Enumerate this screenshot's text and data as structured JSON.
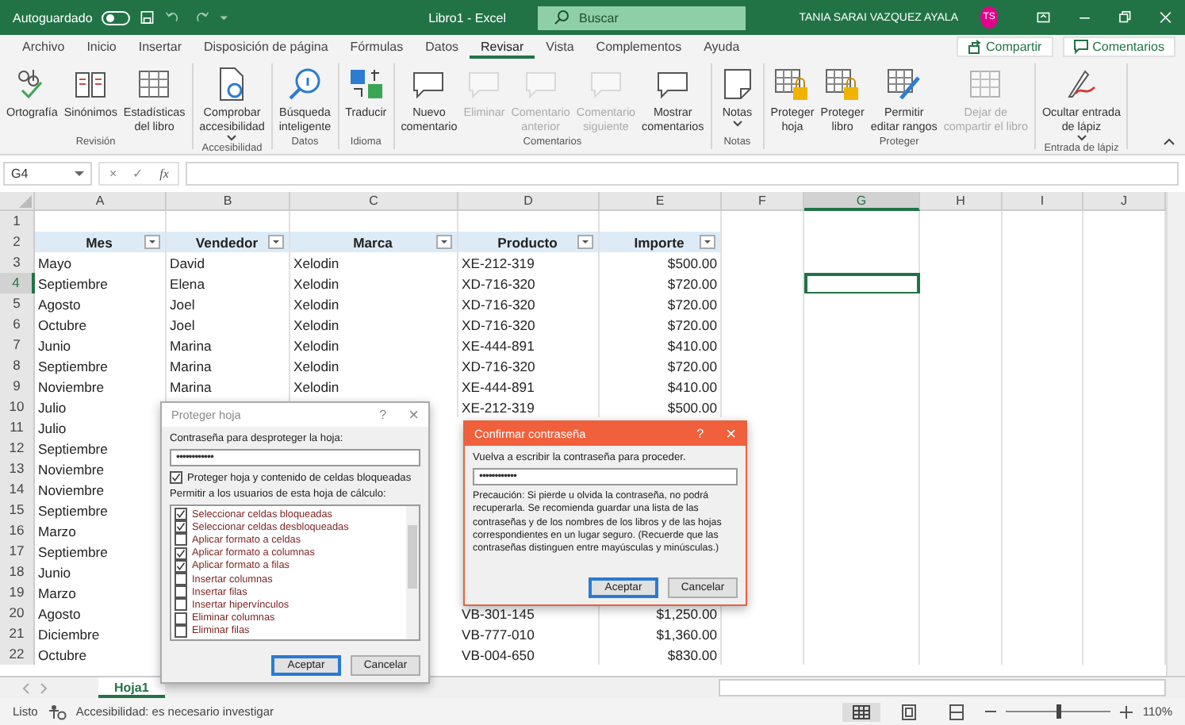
{
  "title_bar": {
    "autosave_label": "Autoguardado",
    "autosave_on": false,
    "title": "Libro1  -  Excel",
    "search_placeholder": "Buscar",
    "user_name": "TANIA SARAI VAZQUEZ AYALA",
    "user_initials": "TS"
  },
  "menu_tabs": [
    {
      "label": "Archivo",
      "selected": false
    },
    {
      "label": "Inicio",
      "selected": false
    },
    {
      "label": "Insertar",
      "selected": false
    },
    {
      "label": "Disposición de página",
      "selected": false
    },
    {
      "label": "Fórmulas",
      "selected": false
    },
    {
      "label": "Datos",
      "selected": false
    },
    {
      "label": "Revisar",
      "selected": true
    },
    {
      "label": "Vista",
      "selected": false
    },
    {
      "label": "Complementos",
      "selected": false
    },
    {
      "label": "Ayuda",
      "selected": false
    }
  ],
  "header_buttons": [
    "Compartir",
    "Comentarios"
  ],
  "ribbon_groups": [
    {
      "label": "Revisión",
      "buttons": [
        {
          "lines": [
            "Ortografía"
          ],
          "disabled": false
        },
        {
          "lines": [
            "Sinónimos"
          ],
          "disabled": false
        },
        {
          "lines": [
            "Estadísticas",
            "del libro"
          ],
          "disabled": false
        }
      ]
    },
    {
      "label": "Accesibilidad",
      "buttons": [
        {
          "lines": [
            "Comprobar",
            "accesibilidad"
          ],
          "disabled": false,
          "has_menu": true
        }
      ]
    },
    {
      "label": "Datos",
      "buttons": [
        {
          "lines": [
            "Búsqueda",
            "inteligente"
          ],
          "disabled": false
        }
      ]
    },
    {
      "label": "Idioma",
      "buttons": [
        {
          "lines": [
            "Traducir"
          ],
          "disabled": false
        }
      ]
    },
    {
      "label": "Comentarios",
      "buttons": [
        {
          "lines": [
            "Nuevo",
            "comentario"
          ],
          "disabled": false
        },
        {
          "lines": [
            "Eliminar"
          ],
          "disabled": true
        },
        {
          "lines": [
            "Comentario",
            "anterior"
          ],
          "disabled": true
        },
        {
          "lines": [
            "Comentario",
            "siguiente"
          ],
          "disabled": true
        },
        {
          "lines": [
            "Mostrar",
            "comentarios"
          ],
          "disabled": false
        }
      ]
    },
    {
      "label": "Notas",
      "buttons": [
        {
          "lines": [
            "Notas"
          ],
          "disabled": false,
          "has_menu": true
        }
      ]
    },
    {
      "label": "Proteger",
      "buttons": [
        {
          "lines": [
            "Proteger",
            "hoja"
          ],
          "disabled": false
        },
        {
          "lines": [
            "Proteger",
            "libro"
          ],
          "disabled": false
        },
        {
          "lines": [
            "Permitir",
            "editar rangos"
          ],
          "disabled": false
        },
        {
          "lines": [
            "Dejar de",
            "compartir el libro"
          ],
          "disabled": true
        }
      ]
    },
    {
      "label": "Entrada de lápiz",
      "buttons": [
        {
          "lines": [
            "Ocultar entrada",
            "de lápiz"
          ],
          "disabled": false,
          "has_menu": true
        }
      ]
    }
  ],
  "formula_bar": {
    "name_box": "G4",
    "buttons": [
      "×",
      "✓",
      "fx"
    ]
  },
  "columns": [
    {
      "letter": "A",
      "selected": false
    },
    {
      "letter": "B",
      "selected": false
    },
    {
      "letter": "C",
      "selected": false
    },
    {
      "letter": "D",
      "selected": false
    },
    {
      "letter": "E",
      "selected": false
    },
    {
      "letter": "F",
      "selected": false
    },
    {
      "letter": "G",
      "selected": true
    },
    {
      "letter": "H",
      "selected": false
    },
    {
      "letter": "I",
      "selected": false
    },
    {
      "letter": "J",
      "selected": false
    }
  ],
  "rows": [
    {
      "number": "1",
      "selected": false
    },
    {
      "number": "2",
      "selected": false,
      "kind": "header",
      "cells": {
        "A": "Mes",
        "B": "Vendedor",
        "C": "Marca",
        "D": "Producto",
        "E": "Importe"
      }
    },
    {
      "number": "3",
      "selected": false,
      "cells": {
        "A": "Mayo",
        "B": "David",
        "C": "Xelodin",
        "D": "XE-212-319",
        "E": "$500.00"
      }
    },
    {
      "number": "4",
      "selected": true,
      "cells": {
        "A": "Septiembre",
        "B": "Elena",
        "C": "Xelodin",
        "D": "XD-716-320",
        "E": "$720.00"
      }
    },
    {
      "number": "5",
      "selected": false,
      "cells": {
        "A": "Agosto",
        "B": "Joel",
        "C": "Xelodin",
        "D": "XD-716-320",
        "E": "$720.00"
      }
    },
    {
      "number": "6",
      "selected": false,
      "cells": {
        "A": "Octubre",
        "B": "Joel",
        "C": "Xelodin",
        "D": "XD-716-320",
        "E": "$720.00"
      }
    },
    {
      "number": "7",
      "selected": false,
      "cells": {
        "A": "Junio",
        "B": "Marina",
        "C": "Xelodin",
        "D": "XE-444-891",
        "E": "$410.00"
      }
    },
    {
      "number": "8",
      "selected": false,
      "cells": {
        "A": "Septiembre",
        "B": "Marina",
        "C": "Xelodin",
        "D": "XD-716-320",
        "E": "$720.00"
      }
    },
    {
      "number": "9",
      "selected": false,
      "cells": {
        "A": "Noviembre",
        "B": "Marina",
        "C": "Xelodin",
        "D": "XE-444-891",
        "E": "$410.00"
      }
    },
    {
      "number": "10",
      "selected": false,
      "cells": {
        "A": "Julio",
        "D": "XE-212-319",
        "E": "$500.00"
      }
    },
    {
      "number": "11",
      "selected": false,
      "cells": {
        "A": "Julio"
      }
    },
    {
      "number": "12",
      "selected": false,
      "cells": {
        "A": "Septiembre"
      }
    },
    {
      "number": "13",
      "selected": false,
      "cells": {
        "A": "Noviembre"
      }
    },
    {
      "number": "14",
      "selected": false,
      "cells": {
        "A": "Noviembre"
      }
    },
    {
      "number": "15",
      "selected": false,
      "cells": {
        "A": "Septiembre"
      }
    },
    {
      "number": "16",
      "selected": false,
      "cells": {
        "A": "Marzo"
      }
    },
    {
      "number": "17",
      "selected": false,
      "cells": {
        "A": "Septiembre"
      }
    },
    {
      "number": "18",
      "selected": false,
      "cells": {
        "A": "Junio"
      }
    },
    {
      "number": "19",
      "selected": false,
      "cells": {
        "A": "Marzo"
      }
    },
    {
      "number": "20",
      "selected": false,
      "cells": {
        "A": "Agosto",
        "D": "VB-301-145",
        "E": "$1,250.00"
      }
    },
    {
      "number": "21",
      "selected": false,
      "cells": {
        "A": "Diciembre",
        "D": "VB-777-010",
        "E": "$1,360.00"
      }
    },
    {
      "number": "22",
      "selected": false,
      "cells": {
        "A": "Octubre",
        "D": "VB-004-650",
        "E": "$830.00"
      }
    }
  ],
  "sheet_tabs": [
    {
      "label": "Hoja1",
      "selected": true
    }
  ],
  "status_bar": {
    "mode": "Listo",
    "accessibility": "Accesibilidad: es necesario investigar",
    "zoom": "110%",
    "zoom_slider": {
      "level": 0.5
    }
  },
  "protect_dialog": {
    "title": "Proteger hoja",
    "help": "?",
    "close": "×",
    "password_label": "Contraseña para desproteger la hoja:",
    "password": "••••••••••••",
    "protect_option": {
      "label": "Proteger hoja y contenido de celdas bloqueadas",
      "checked": true
    },
    "permissions_label": "Permitir a los usuarios de esta hoja de cálculo:",
    "permissions": [
      {
        "label": "Seleccionar celdas bloqueadas",
        "checked": true
      },
      {
        "label": "Seleccionar celdas desbloqueadas",
        "checked": true
      },
      {
        "label": "Aplicar formato a celdas",
        "checked": false
      },
      {
        "label": "Aplicar formato a columnas",
        "checked": true
      },
      {
        "label": "Aplicar formato a filas",
        "checked": true
      },
      {
        "label": "Insertar columnas",
        "checked": false
      },
      {
        "label": "Insertar filas",
        "checked": false
      },
      {
        "label": "Insertar hipervínculos",
        "checked": false
      },
      {
        "label": "Eliminar columnas",
        "checked": false
      },
      {
        "label": "Eliminar filas",
        "checked": false
      }
    ],
    "buttons": [
      "Aceptar",
      "Cancelar"
    ]
  },
  "confirm_dialog": {
    "title": "Confirmar contraseña",
    "help": "?",
    "close": "×",
    "label": "Vuelva a escribir la contraseña para proceder.",
    "password": "••••••••••••",
    "warning": "Precaución: Si pierde u olvida la contraseña, no podrá recuperarla. Se recomienda guardar una lista de las contraseñas y de los nombres de los libros y de las hojas correspondientes en un lugar seguro. (Recuerde que las contraseñas distinguen entre mayúsculas y minúsculas.)",
    "buttons": [
      "Aceptar",
      "Cancelar"
    ]
  }
}
